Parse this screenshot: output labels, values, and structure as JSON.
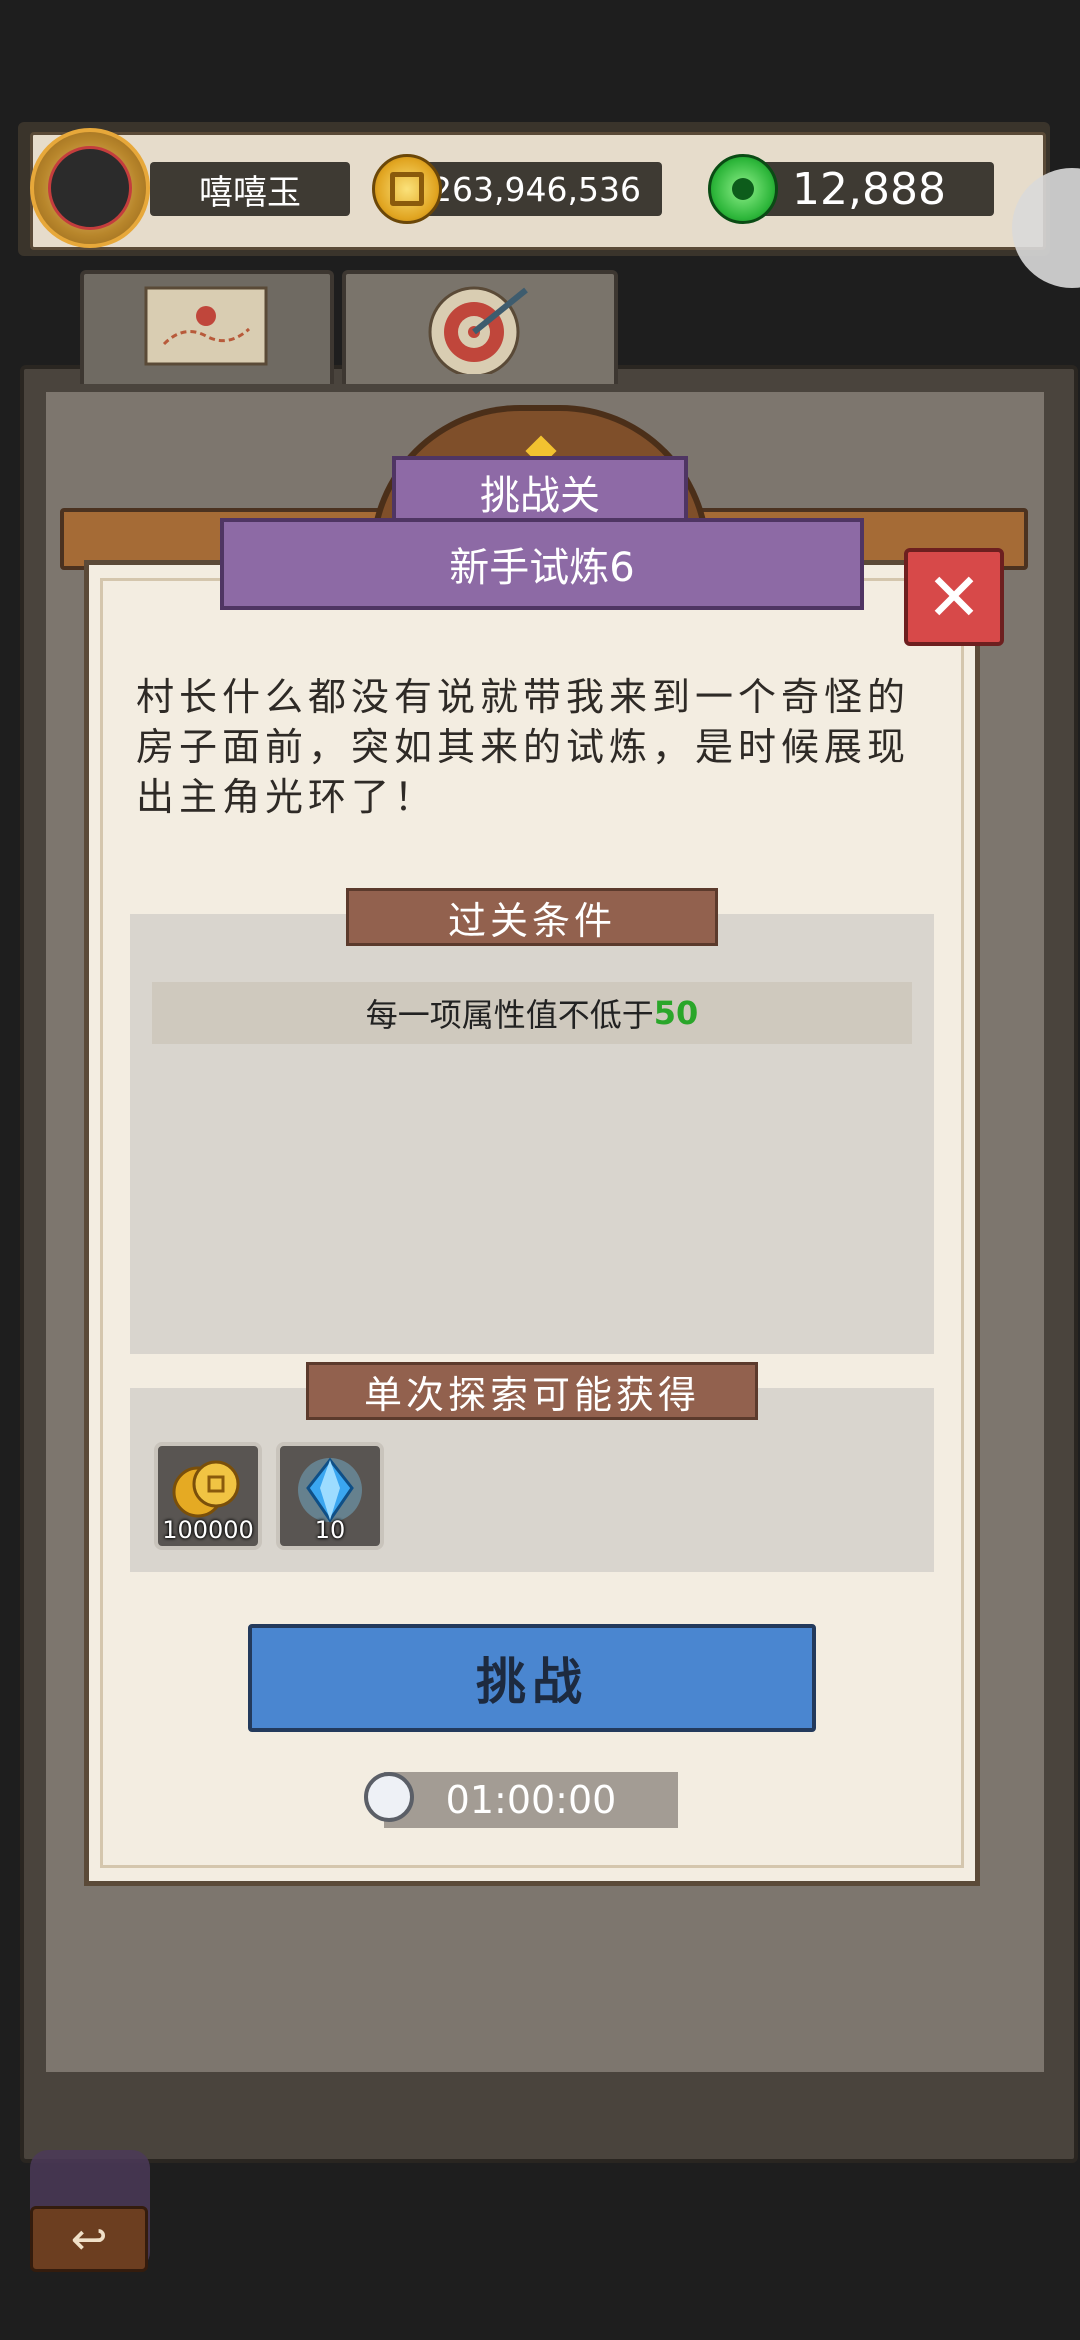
{
  "header": {
    "player_name": "嘻嘻玉",
    "gold": "263,946,536",
    "jade": "12,888"
  },
  "dialog": {
    "category": "挑战关",
    "title": "新手试炼6",
    "description": "村长什么都没有说就带我来到一个奇怪的房子面前，突如其来的试炼，是时候展现出主角光环了！",
    "conditions": {
      "header": "过关条件",
      "items": [
        {
          "text": "每一项属性值不低于",
          "value": "50",
          "value_color": "#2aa62a"
        }
      ]
    },
    "rewards": {
      "header": "单次探索可能获得",
      "items": [
        {
          "icon": "gold-coins-icon",
          "count": "100000"
        },
        {
          "icon": "blue-crystal-icon",
          "count": "10"
        }
      ]
    },
    "challenge_label": "挑战",
    "timer": "01:00:00"
  },
  "colors": {
    "accent_purple": "#8d6aa5",
    "button_blue": "#4a86d0",
    "close_red": "#d74949"
  }
}
